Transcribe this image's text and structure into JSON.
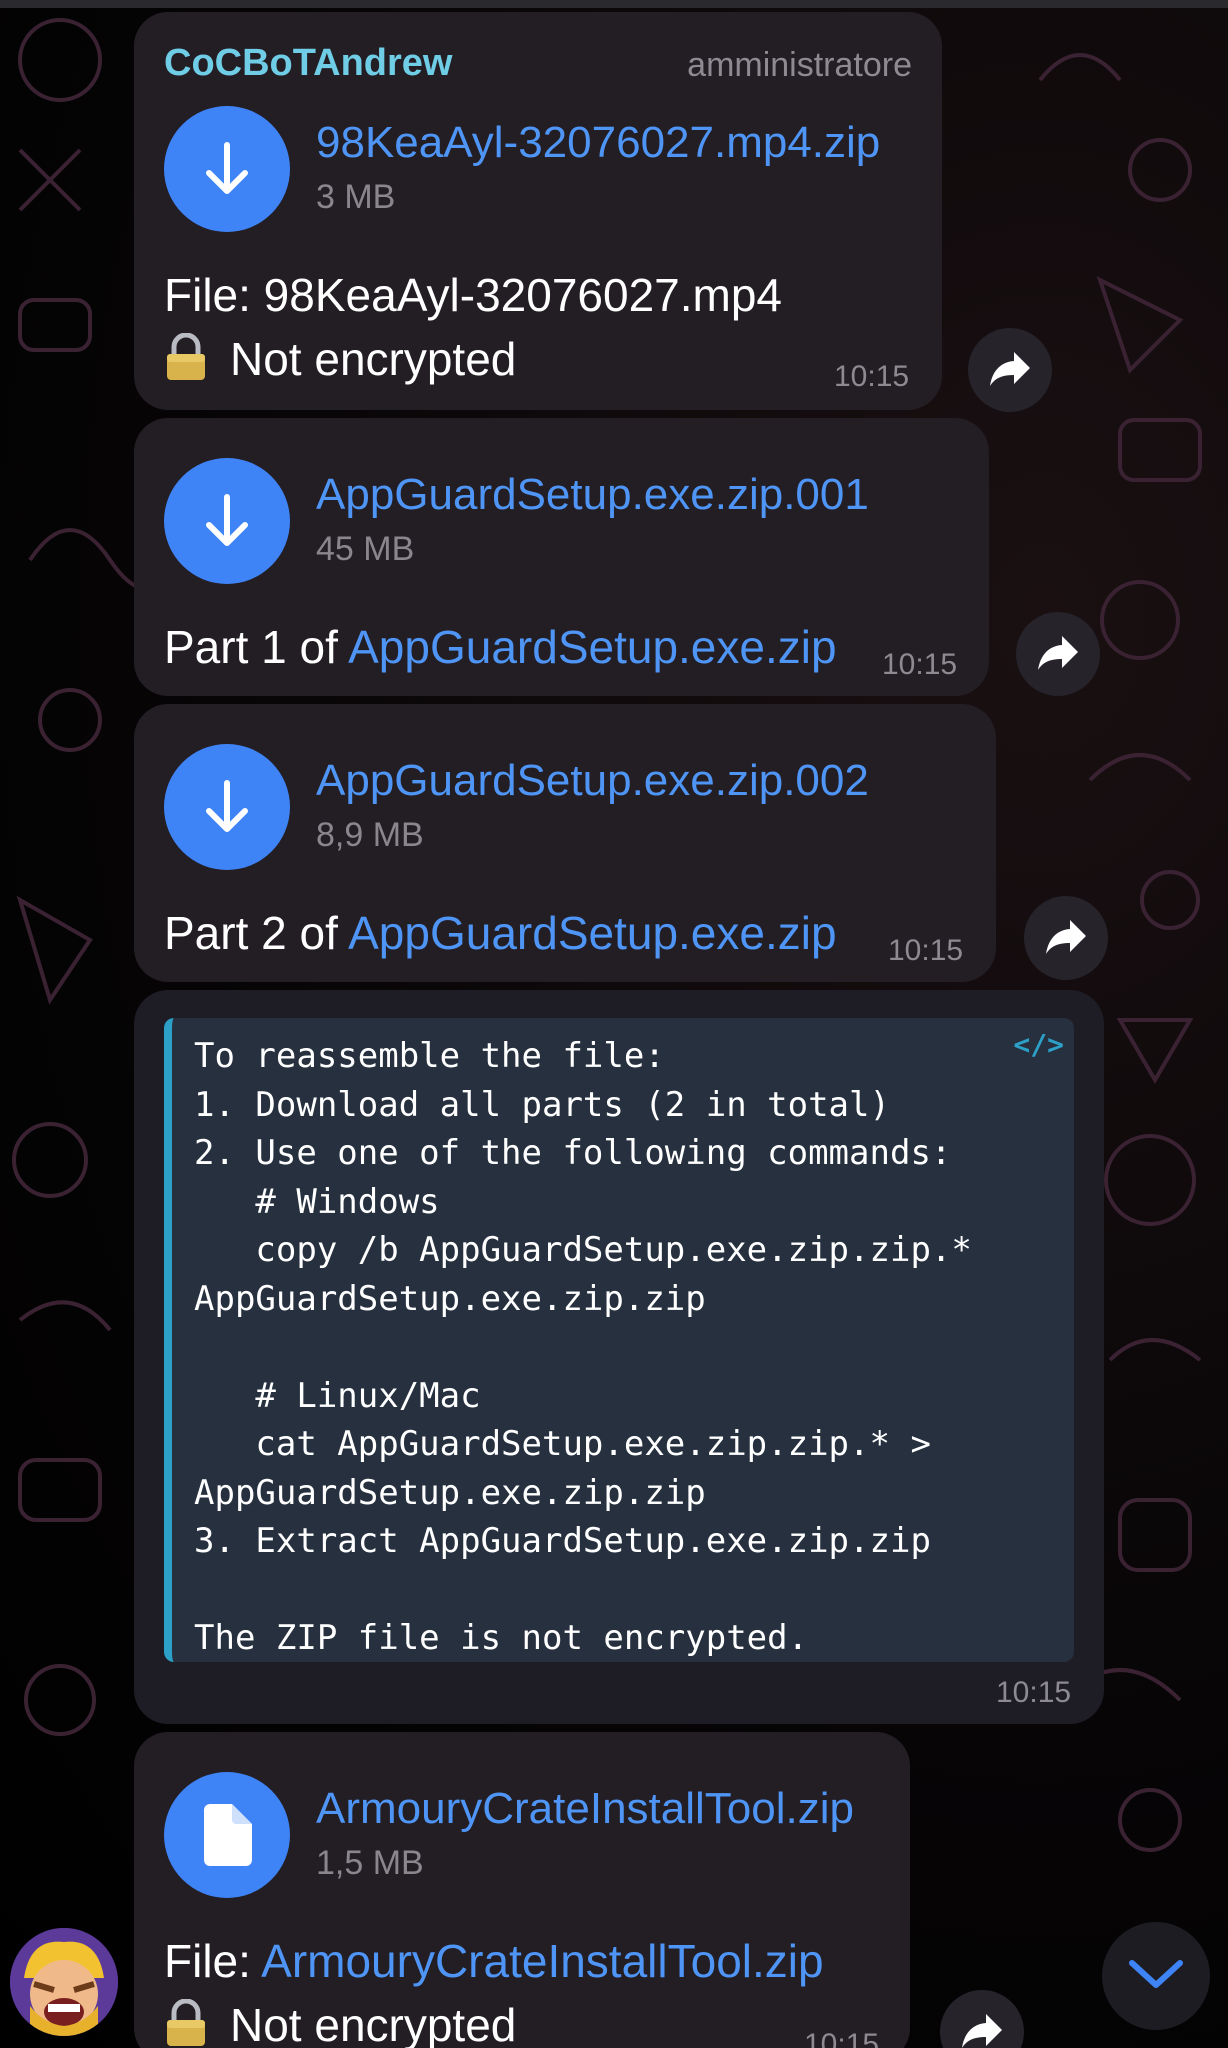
{
  "colors": {
    "bubble": "#231d24",
    "accent_blue": "#3f84f6",
    "link_blue": "#4e95f5",
    "sender_cyan": "#6fcde6",
    "code_bar": "#2da0c7",
    "muted_text": "#8e8a91"
  },
  "messages": [
    {
      "sender": "CoCBoTAndrew",
      "role": "amministratore",
      "file_icon": "download-arrow-icon",
      "file_name": "98KeaAyl-32076027.mp4.zip",
      "file_size": "3 MB",
      "caption_line1": "File: 98KeaAyl-32076027.mp4",
      "caption_line2": "Not encrypted",
      "lock_icon": "lock-icon",
      "time": "10:15"
    },
    {
      "file_icon": "download-arrow-icon",
      "file_name": "AppGuardSetup.exe.zip.001",
      "file_size": "45 MB",
      "caption_prefix": "Part 1 of ",
      "caption_link": "AppGuardSetup.exe.zip",
      "time": "10:15"
    },
    {
      "file_icon": "download-arrow-icon",
      "file_name": "AppGuardSetup.exe.zip.002",
      "file_size": "8,9 MB",
      "caption_prefix": "Part 2 of ",
      "caption_link": "AppGuardSetup.exe.zip",
      "time": "10:15"
    },
    {
      "code_icon": "</>",
      "code": "To reassemble the file:\n1. Download all parts (2 in total)\n2. Use one of the following commands:\n   # Windows\n   copy /b AppGuardSetup.exe.zip.zip.*\nAppGuardSetup.exe.zip.zip\n\n   # Linux/Mac\n   cat AppGuardSetup.exe.zip.zip.* >\nAppGuardSetup.exe.zip.zip\n3. Extract AppGuardSetup.exe.zip.zip\n\nThe ZIP file is not encrypted.",
      "time": "10:15"
    },
    {
      "file_icon": "document-icon",
      "file_name": "ArmouryCrateInstallTool.zip",
      "file_size": "1,5 MB",
      "caption_prefix": "File: ",
      "caption_link": "ArmouryCrateInstallTool.zip",
      "caption_line2": "Not encrypted",
      "lock_icon": "lock-icon",
      "time": "10:15"
    }
  ],
  "icons": {
    "share": "share-arrow-icon",
    "scroll_down": "chevron-down-icon",
    "avatar": "clash-of-clans-barbarian-avatar"
  }
}
